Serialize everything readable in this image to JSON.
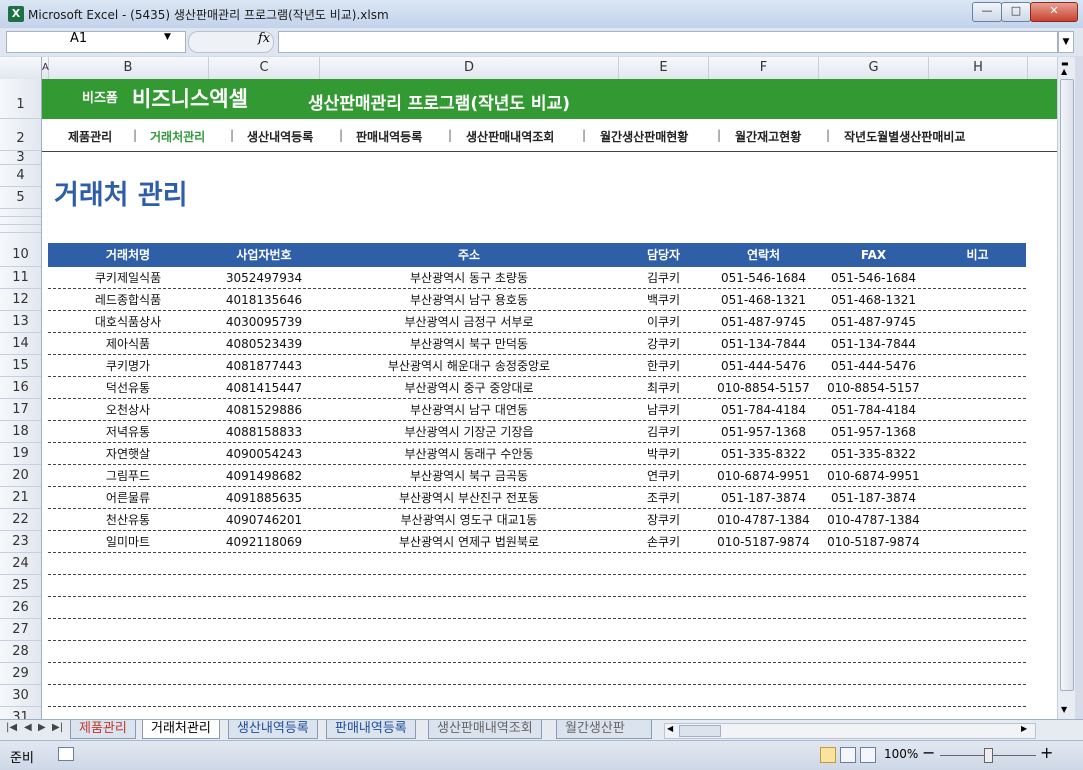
{
  "window": {
    "title": "Microsoft Excel - (5435) 생산판매관리 프로그램(작년도 비교).xlsm",
    "app_icon": "X",
    "minimize": "—",
    "maximize": "□",
    "close": "✕"
  },
  "formula_bar": {
    "name_box": "A1",
    "fx": "fx",
    "value": ""
  },
  "columns": [
    "A",
    "B",
    "C",
    "D",
    "E",
    "F",
    "G",
    "H"
  ],
  "rows": [
    "1",
    "2",
    "3",
    "4",
    "5",
    "",
    "",
    "",
    "10",
    "11",
    "12",
    "13",
    "14",
    "15",
    "16",
    "17",
    "18",
    "19",
    "20",
    "21",
    "22",
    "23",
    "24",
    "25",
    "26",
    "27",
    "28",
    "29",
    "30",
    "31"
  ],
  "banner": {
    "brand_small": "비즈폼",
    "brand_big": "비즈니스엑셀",
    "program_title": "생산판매관리 프로그램(작년도 비교)"
  },
  "menu": [
    "제품관리",
    "거래처관리",
    "생산내역등록",
    "판매내역등록",
    "생산판매내역조회",
    "월간생산판매현황",
    "월간재고현황",
    "작년도월별생산판매비교"
  ],
  "active_menu": "거래처관리",
  "page_heading": "거래처 관리",
  "table": {
    "headers": [
      "거래처명",
      "사업자번호",
      "주소",
      "담당자",
      "연락처",
      "FAX",
      "비고"
    ],
    "rows": [
      [
        "쿠키제일식품",
        "3052497934",
        "부산광역시 동구 초량동",
        "김쿠키",
        "051-546-1684",
        "051-546-1684",
        ""
      ],
      [
        "레드종합식품",
        "4018135646",
        "부산광역시 남구 용호동",
        "백쿠키",
        "051-468-1321",
        "051-468-1321",
        ""
      ],
      [
        "대호식품상사",
        "4030095739",
        "부산광역시 금정구 서부로",
        "이쿠키",
        "051-487-9745",
        "051-487-9745",
        ""
      ],
      [
        "제아식품",
        "4080523439",
        "부산광역시 북구 만덕동",
        "강쿠키",
        "051-134-7844",
        "051-134-7844",
        ""
      ],
      [
        "쿠키명가",
        "4081877443",
        "부산광역시 해운대구 송정중앙로",
        "한쿠키",
        "051-444-5476",
        "051-444-5476",
        ""
      ],
      [
        "덕선유통",
        "4081415447",
        "부산광역시 중구 중앙대로",
        "최쿠키",
        "010-8854-5157",
        "010-8854-5157",
        ""
      ],
      [
        "오천상사",
        "4081529886",
        "부산광역시 남구 대연동",
        "남쿠키",
        "051-784-4184",
        "051-784-4184",
        ""
      ],
      [
        "저녁유통",
        "4088158833",
        "부산광역시 기장군 기장읍",
        "김쿠키",
        "051-957-1368",
        "051-957-1368",
        ""
      ],
      [
        "자연햇살",
        "4090054243",
        "부산광역시 동래구 수안동",
        "박쿠키",
        "051-335-8322",
        "051-335-8322",
        ""
      ],
      [
        "그림푸드",
        "4091498682",
        "부산광역시 북구 금곡동",
        "연쿠키",
        "010-6874-9951",
        "010-6874-9951",
        ""
      ],
      [
        "어른물류",
        "4091885635",
        "부산광역시 부산진구 전포동",
        "조쿠키",
        "051-187-3874",
        "051-187-3874",
        ""
      ],
      [
        "천산유통",
        "4090746201",
        "부산광역시 영도구 대교1동",
        "장쿠키",
        "010-4787-1384",
        "010-4787-1384",
        ""
      ],
      [
        "일미마트",
        "4092118069",
        "부산광역시 연제구 법원북로",
        "손쿠키",
        "010-5187-9874",
        "010-5187-9874",
        ""
      ]
    ]
  },
  "sheet_tabs": [
    "제품관리",
    "거래처관리",
    "생산내역등록",
    "판매내역등록",
    "생산판매내역조회",
    "월간생산판"
  ],
  "active_tab": "거래처관리",
  "tab_nav": [
    "|◀",
    "◀",
    "▶",
    "▶|"
  ],
  "status": {
    "ready": "준비",
    "zoom": "100%",
    "zoom_out": "−",
    "zoom_in": "+"
  },
  "colors": {
    "banner_green": "#339933",
    "header_blue": "#2f5fa6",
    "heading_blue": "#2e5ea8",
    "active_menu_green": "#33993b"
  }
}
